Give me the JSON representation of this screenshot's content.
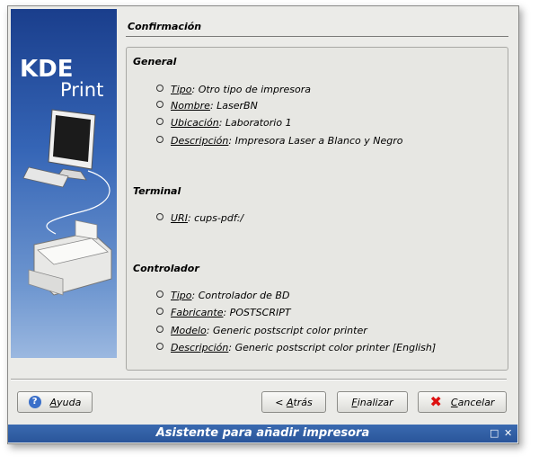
{
  "window": {
    "title": "Asistente para añadir impresora"
  },
  "banner": {
    "brand_top": "KDE",
    "brand_bottom": "Print"
  },
  "page": {
    "title": "Confirmación"
  },
  "sections": [
    {
      "heading": "General",
      "items": [
        {
          "key": "Tipo",
          "value": ": Otro tipo de impresora"
        },
        {
          "key": "Nombre",
          "value": ": LaserBN"
        },
        {
          "key": "Ubicación",
          "value": ": Laboratorio 1"
        },
        {
          "key": "Descripción",
          "value": ": Impresora Laser a Blanco y Negro"
        }
      ]
    },
    {
      "heading": "Terminal",
      "items": [
        {
          "key": "URI",
          "value": ": cups-pdf:/"
        }
      ]
    },
    {
      "heading": "Controlador",
      "items": [
        {
          "key": "Tipo",
          "value": ": Controlador de BD"
        },
        {
          "key": "Fabricante",
          "value": ": POSTSCRIPT"
        },
        {
          "key": "Modelo",
          "value": ": Generic postscript color printer"
        },
        {
          "key": "Descripción",
          "value": ": Generic postscript color printer [English]"
        }
      ]
    }
  ],
  "buttons": {
    "help": {
      "label_u": "A",
      "label_rest": "yuda"
    },
    "back": {
      "prefix": "< ",
      "label_u": "A",
      "label_rest": "trás"
    },
    "finish": {
      "label_u": "F",
      "label_rest": "inalizar"
    },
    "cancel": {
      "label_u": "C",
      "label_rest": "ancelar"
    }
  },
  "icons": {
    "help": "help-icon",
    "cancel": "cancel-icon"
  },
  "colors": {
    "banner": "#2a559a",
    "titlebar": "#2a559a",
    "cancel": "#dd1111"
  }
}
